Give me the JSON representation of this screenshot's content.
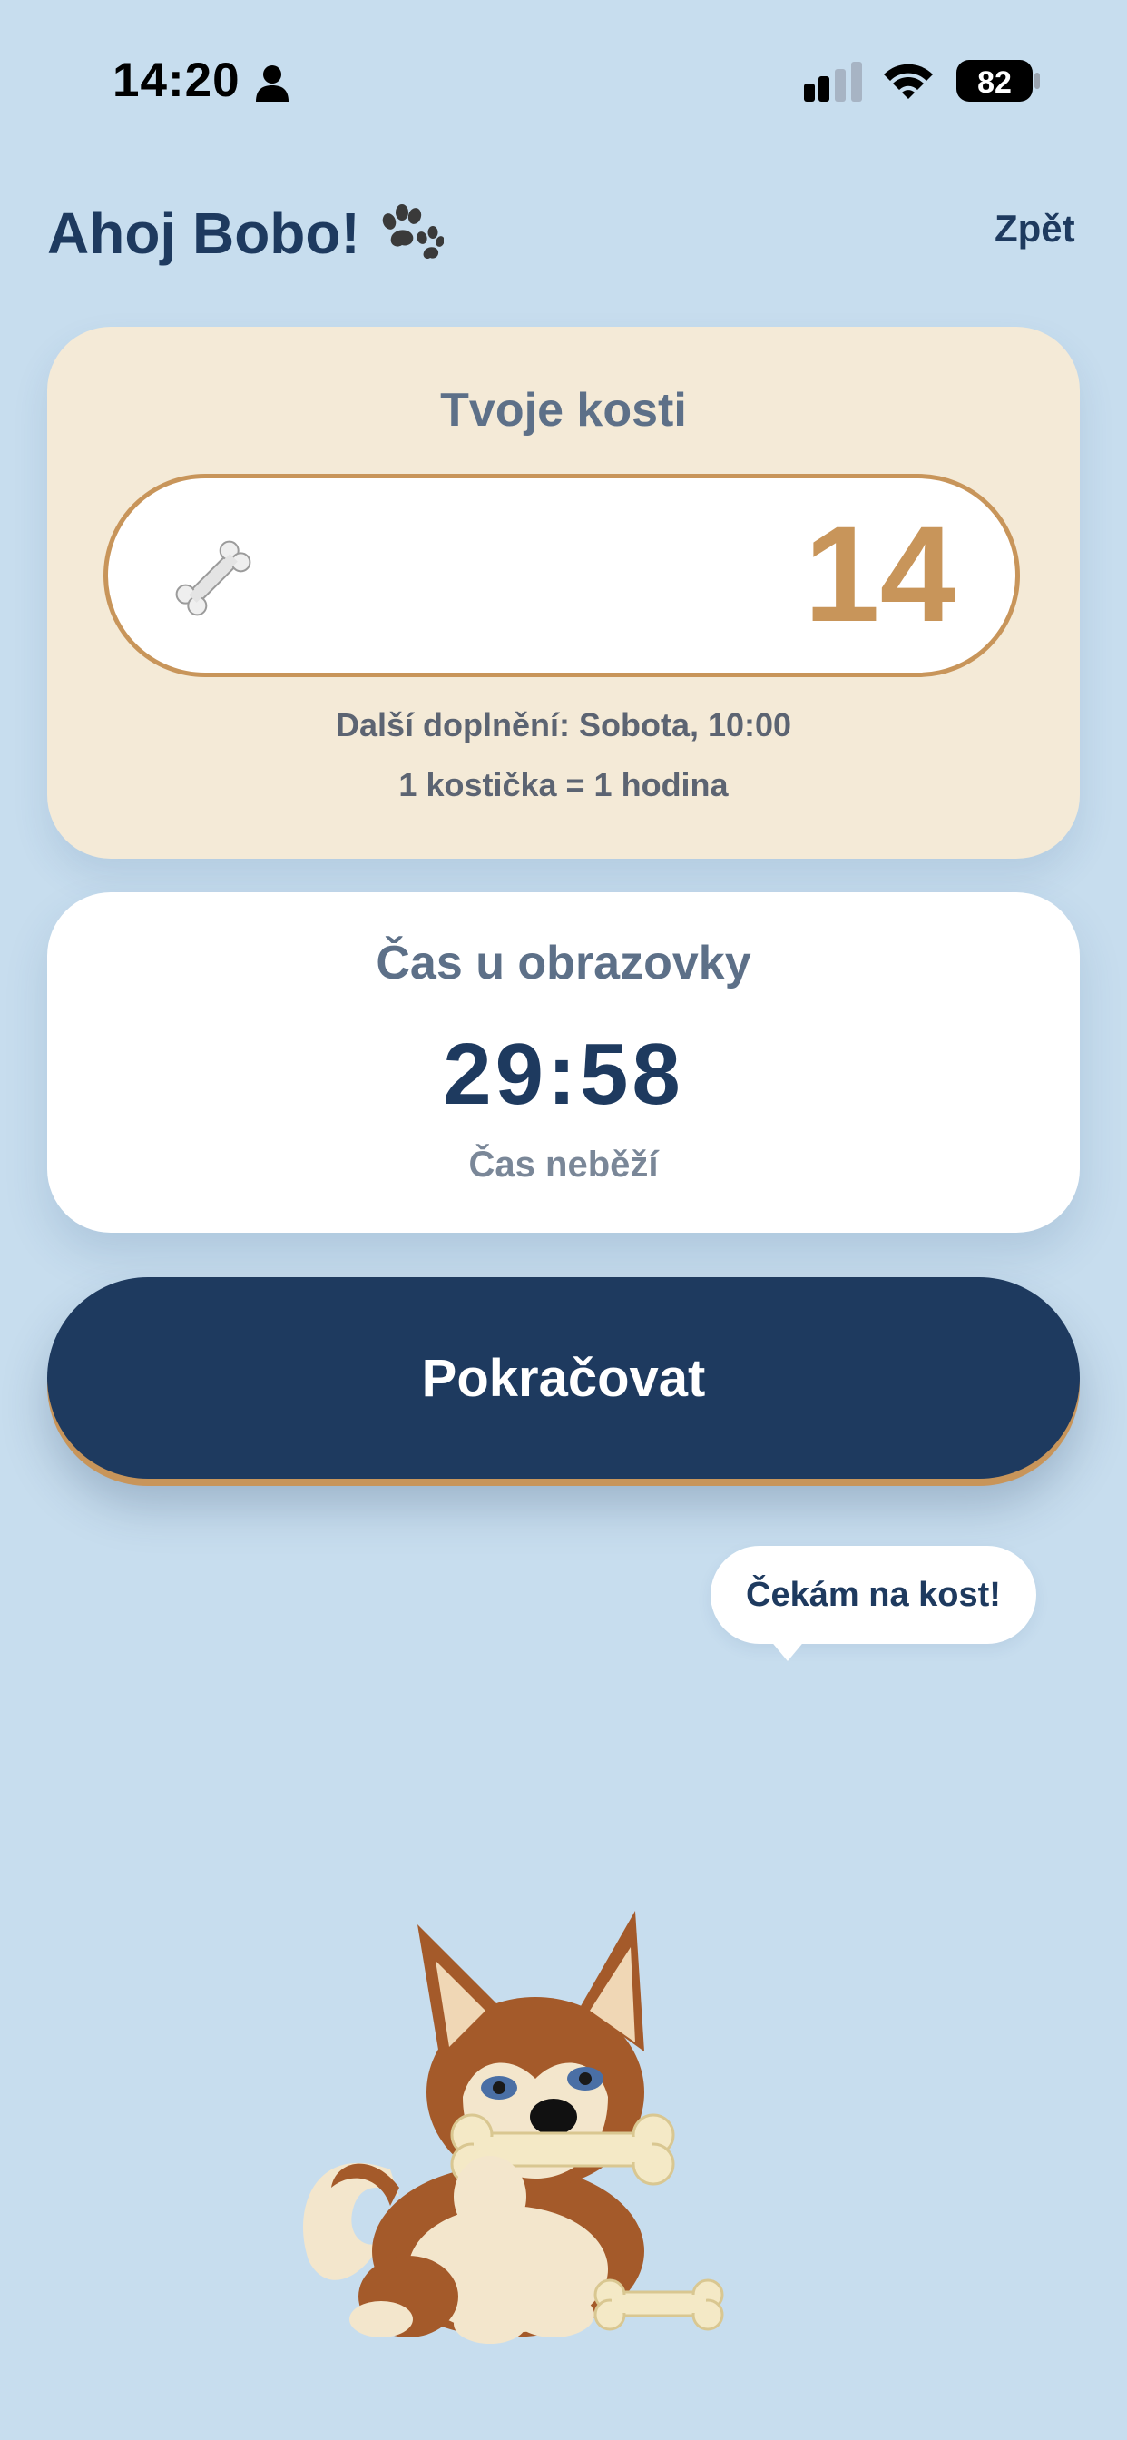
{
  "status_bar": {
    "time": "14:20",
    "battery": "82",
    "icons": [
      "person-icon",
      "cellular-signal-icon",
      "wifi-icon",
      "battery-icon"
    ]
  },
  "header": {
    "greeting": "Ahoj Bobo!",
    "greeting_icon": "paw-icon",
    "back_label": "Zpět"
  },
  "bones": {
    "title": "Tvoje kosti",
    "icon": "bone-icon",
    "count": "14",
    "next_refill": "Další doplnění: Sobota, 10:00",
    "rate": "1 kostička = 1 hodina"
  },
  "screen_time": {
    "title": "Čas u obrazovky",
    "value": "29:58",
    "status": "Čas neběží"
  },
  "actions": {
    "continue_label": "Pokračovat"
  },
  "mascot": {
    "speech": "Čekám na kost!",
    "image": "dog-with-bone-illustration"
  },
  "colors": {
    "background": "#c7ddee",
    "primary": "#1e3a5f",
    "accent": "#c8955a",
    "bones_card": "#f4ead7",
    "muted_text": "#5d7088"
  }
}
